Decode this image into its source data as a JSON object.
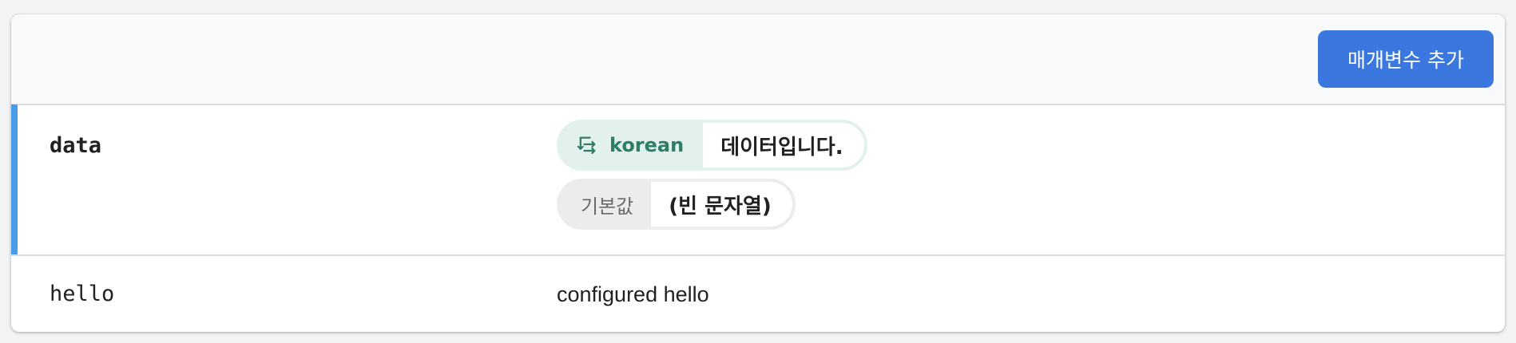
{
  "toolbar": {
    "add_button_label": "매개변수 추가"
  },
  "parameters": [
    {
      "name": "data",
      "selected": true,
      "source_icon": "swap-horiz-icon",
      "source_label": "korean",
      "source_value": "데이터입니다.",
      "default_label": "기본값",
      "default_value": "(빈 문자열)"
    },
    {
      "name": "hello",
      "selected": false,
      "value": "configured hello"
    }
  ],
  "colors": {
    "accent_bar": "#4a9ce8",
    "primary_button": "#3a78e0",
    "source_chip_bg": "#e3f1ee",
    "source_chip_text": "#2e7d67",
    "default_chip_bg": "#ececec"
  }
}
